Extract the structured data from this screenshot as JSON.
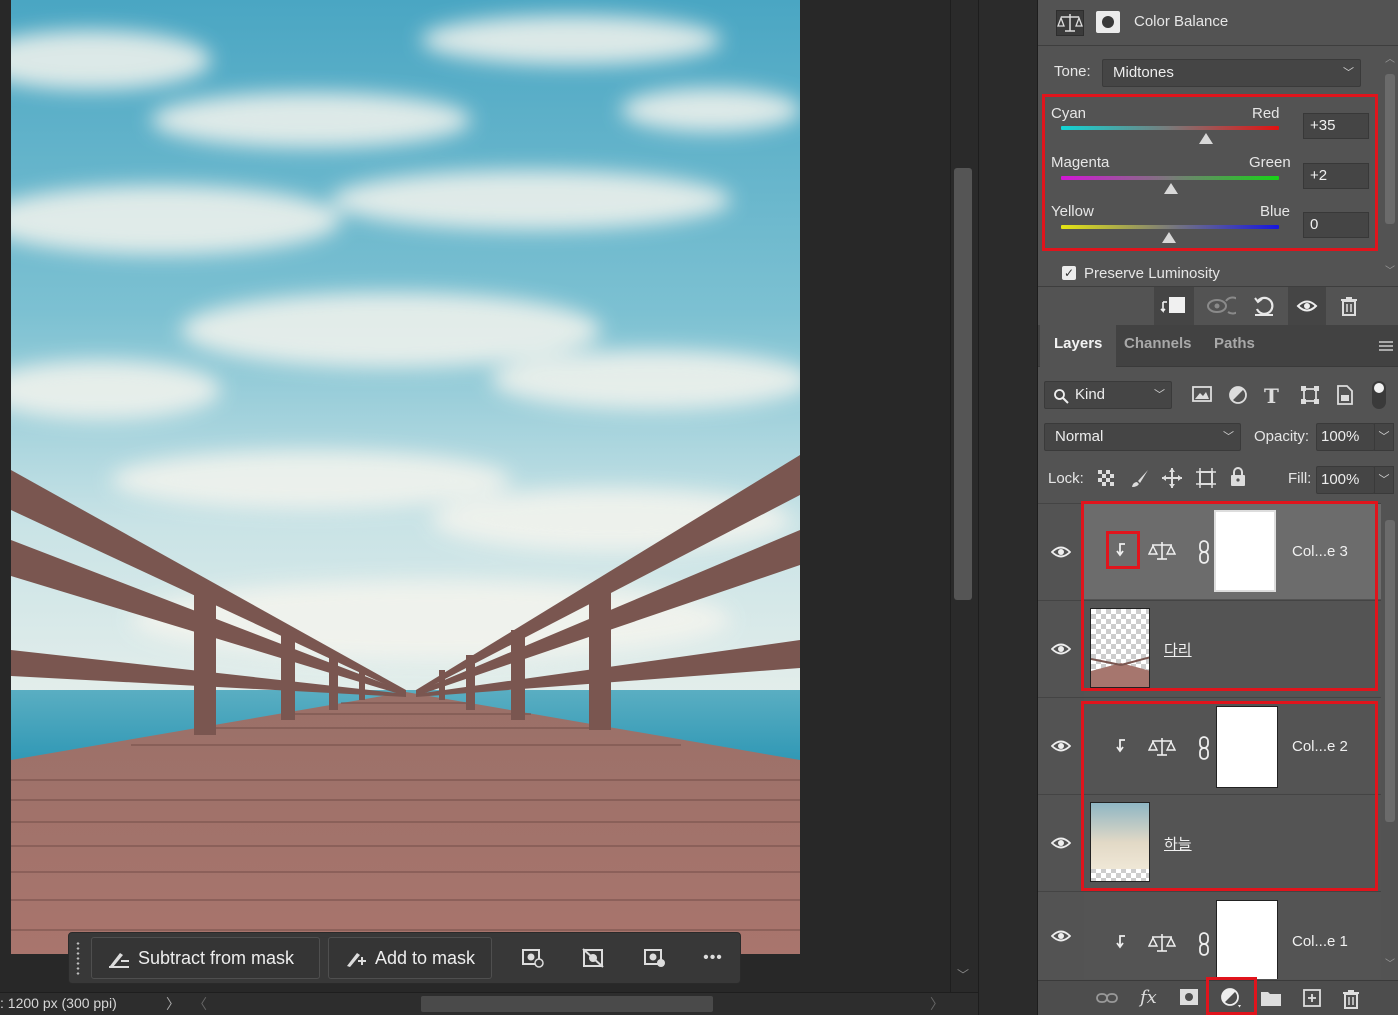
{
  "properties": {
    "title": "Color Balance",
    "tone_label": "Tone:",
    "tone_value": "Midtones",
    "sliders": [
      {
        "left": "Cyan",
        "right": "Red",
        "value": "+35"
      },
      {
        "left": "Magenta",
        "right": "Green",
        "value": "+2"
      },
      {
        "left": "Yellow",
        "right": "Blue",
        "value": "0"
      }
    ],
    "preserve_luminosity": "Preserve Luminosity"
  },
  "layers_panel": {
    "tabs": [
      "Layers",
      "Channels",
      "Paths"
    ],
    "filter_kind": "Kind",
    "blend_mode": "Normal",
    "opacity_label": "Opacity:",
    "opacity_value": "100%",
    "lock_label": "Lock:",
    "fill_label": "Fill:",
    "fill_value": "100%",
    "layers": [
      {
        "name": "Col...e 3",
        "type": "color-balance",
        "clipped": true,
        "selected": true
      },
      {
        "name": "다리",
        "type": "pixel"
      },
      {
        "name": "Col...e 2",
        "type": "color-balance",
        "clipped": true
      },
      {
        "name": "하늘",
        "type": "pixel"
      },
      {
        "name": "Col...e 1",
        "type": "color-balance",
        "clipped": true
      }
    ]
  },
  "mask_toolbar": {
    "subtract": "Subtract from mask",
    "add": "Add to mask",
    "more": "•••"
  },
  "status": {
    "doc_info": ": 1200 px (300 ppi)"
  },
  "colors": {
    "highlight": "#e0141c",
    "panel_bg": "#535353"
  }
}
